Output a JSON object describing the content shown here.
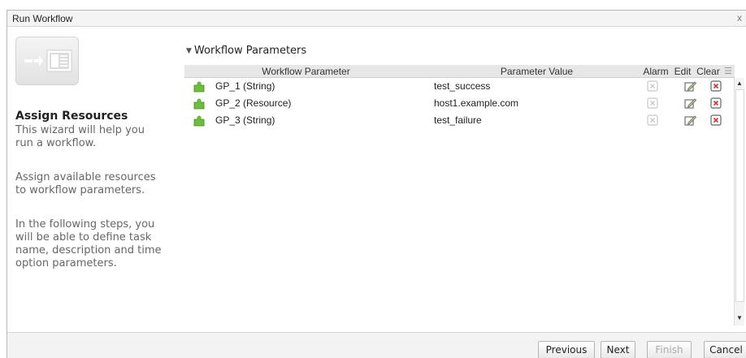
{
  "window": {
    "title": "Run Workflow",
    "close_glyph": "x"
  },
  "sidebar": {
    "icon": "workflow-wizard-icon",
    "heading": "Assign Resources",
    "paragraphs": [
      "This wizard will help you\nrun a workflow.",
      "Assign available resources\nto workflow parameters.",
      "In the following steps, you\nwill be able to define task\nname, description and time\noption parameters."
    ]
  },
  "section": {
    "title": "Workflow Parameters",
    "expanded_icon": "triangle-down-icon"
  },
  "grid": {
    "columns": {
      "parameter": "Workflow Parameter",
      "value": "Parameter Value",
      "alarm": "Alarm",
      "edit": "Edit",
      "clear": "Clear",
      "column_chooser_icon": "columns-icon"
    },
    "rows": [
      {
        "parameter": "GP_1 (String)",
        "value": "test_success"
      },
      {
        "parameter": "GP_2 (Resource)",
        "value": "host1.example.com"
      },
      {
        "parameter": "GP_3 (String)",
        "value": "test_failure"
      }
    ]
  },
  "footer": {
    "previous": "Previous",
    "next": "Next",
    "finish": "Finish",
    "cancel": "Cancel"
  },
  "colors": {
    "puzzle": "#6cbf3a",
    "clear_red": "#d23a3a",
    "edit_blue": "#3e6fb0"
  }
}
